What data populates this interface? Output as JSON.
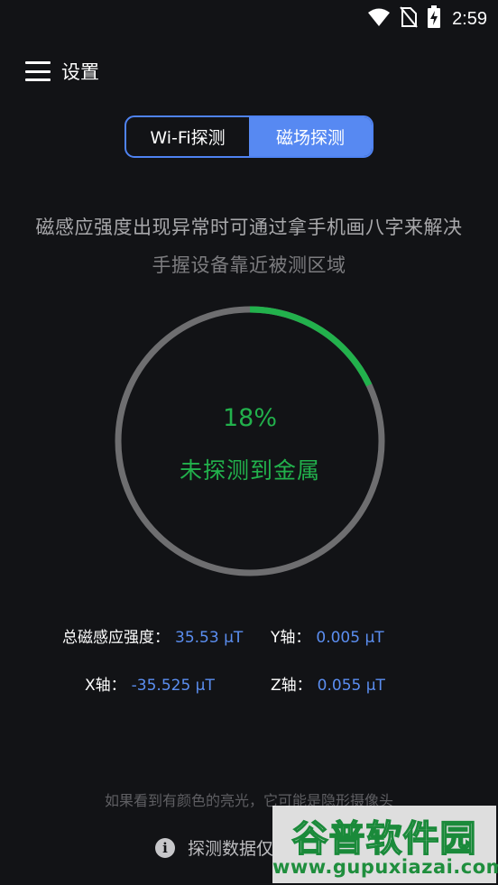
{
  "status_bar": {
    "time": "2:59",
    "icons": [
      "wifi-icon",
      "no-sim-icon",
      "battery-charging-icon"
    ]
  },
  "app_bar": {
    "menu_icon": "hamburger-menu-icon",
    "title": "设置"
  },
  "tabs": [
    {
      "label": "Wi-Fi探测",
      "active": false
    },
    {
      "label": "磁场探测",
      "active": true
    }
  ],
  "hints": {
    "main": "磁感应强度出现异常时可通过拿手机画八字来解决",
    "sub": "手握设备靠近被测区域"
  },
  "gauge": {
    "percent_text": "18%",
    "progress": 0.18,
    "status": "未探测到金属",
    "accent_color": "#22b14c",
    "track_color": "#6e6e70"
  },
  "readings": {
    "total": {
      "label": "总磁感应强度：",
      "value": "35.53 μT"
    },
    "y": {
      "label": "Y轴：",
      "value": "0.005 μT"
    },
    "x": {
      "label": "X轴：",
      "value": "-35.525 μT"
    },
    "z": {
      "label": "Z轴：",
      "value": "0.055 μT"
    }
  },
  "footer": {
    "note": "如果看到有颜色的亮光，它可能是隐形摄像头",
    "info_icon": "info-icon",
    "info_text": "探测数据仅"
  },
  "watermark": {
    "title": "谷普软件园",
    "url": "www.gupuxiazai.com"
  }
}
